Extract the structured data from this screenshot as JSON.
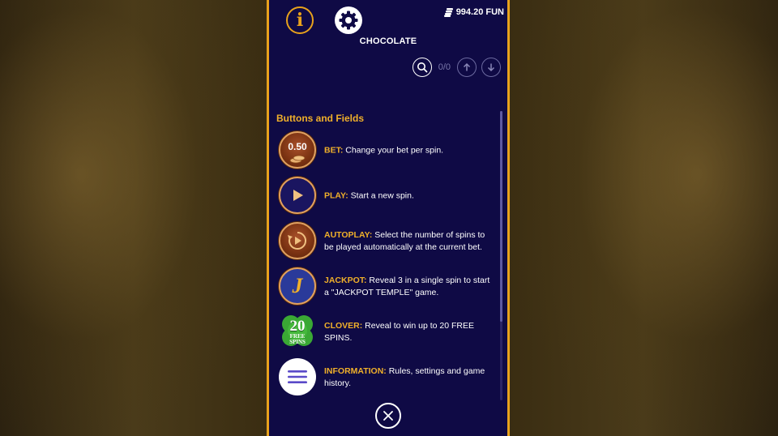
{
  "header": {
    "balance": "994.20 FUN",
    "game_title": "CHOCOLATE"
  },
  "search": {
    "count": "0/0"
  },
  "section": {
    "title": "Buttons and Fields"
  },
  "items": [
    {
      "icon": "bet-icon",
      "icon_value": "0.50",
      "key": "BET:",
      "desc": " Change your bet per spin."
    },
    {
      "icon": "play-icon",
      "key": "PLAY:",
      "desc": " Start a new spin."
    },
    {
      "icon": "autoplay-icon",
      "key": "AUTOPLAY:",
      "desc": " Select the number of spins to be played automatically at the current bet."
    },
    {
      "icon": "jackpot-icon",
      "icon_value": "J",
      "key": "JACKPOT:",
      "desc": " Reveal 3 in a single spin to start a \"JACKPOT TEMPLE\" game."
    },
    {
      "icon": "clover-icon",
      "icon_value": "20",
      "icon_sub1": "FREE",
      "icon_sub2": "SPINS",
      "key": "CLOVER:",
      "desc": " Reveal to win up to 20 FREE SPINS."
    },
    {
      "icon": "menu-icon",
      "key": "INFORMATION:",
      "desc": " Rules, settings and game history."
    }
  ],
  "colors": {
    "accent": "#e8a21c",
    "panel": "#0f0a45",
    "highlight_text": "#f0b02a"
  }
}
